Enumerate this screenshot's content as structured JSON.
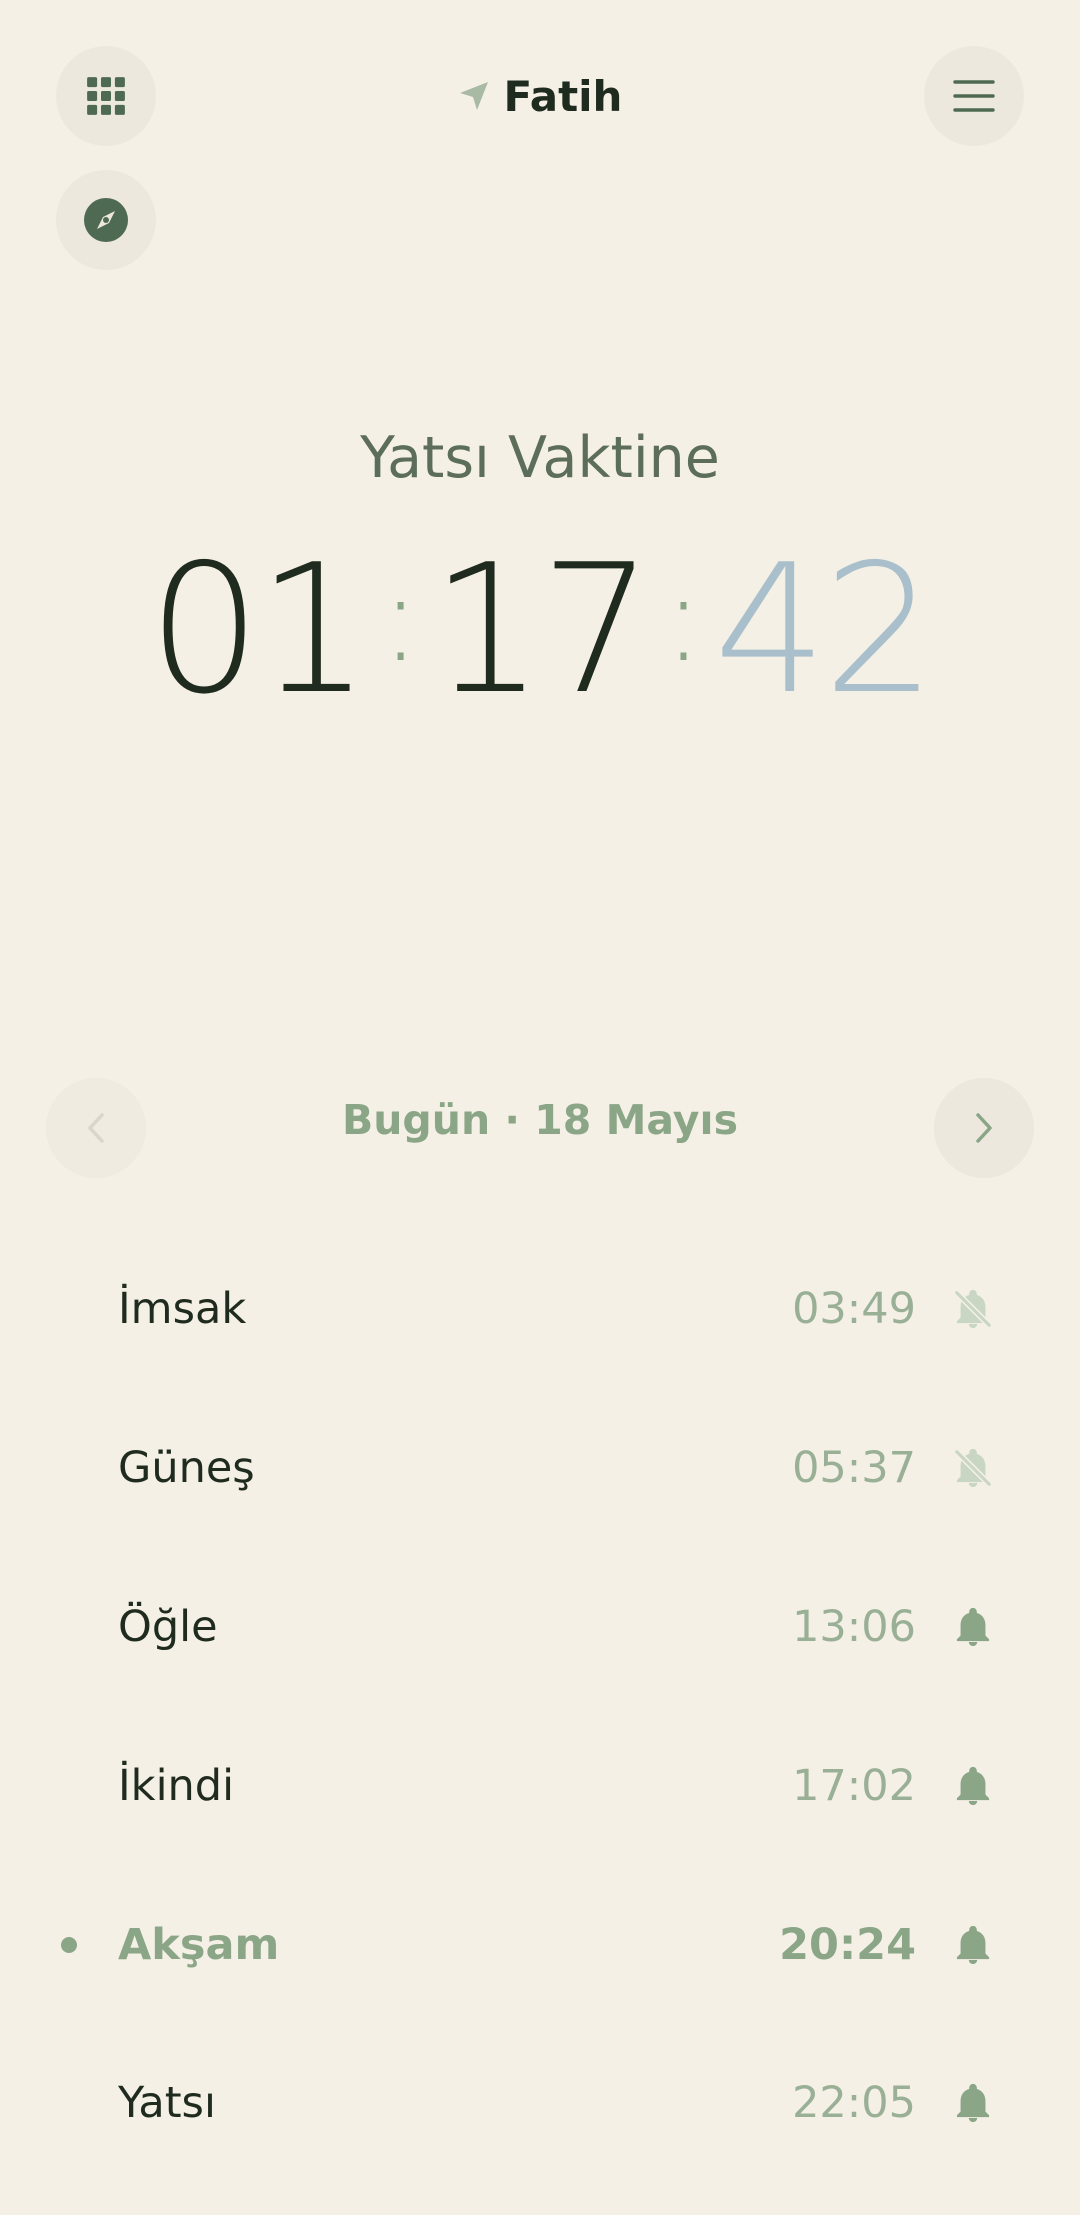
{
  "header": {
    "location": "Fatih",
    "icons": {
      "apps": "grid-icon",
      "qibla": "compass-icon",
      "menu": "hamburger-menu-icon",
      "location": "location-arrow-icon"
    }
  },
  "countdown": {
    "label": "Yatsı Vaktine",
    "hours": "01",
    "minutes": "17",
    "seconds": "42",
    "separator": ":"
  },
  "date_nav": {
    "label": "Bugün · 18 Mayıs",
    "prev_icon": "chevron-left-icon",
    "next_icon": "chevron-right-icon"
  },
  "prayers": [
    {
      "name": "İmsak",
      "time": "03:49",
      "alarm": "bell-off-icon"
    },
    {
      "name": "Güneş",
      "time": "05:37",
      "alarm": "bell-off-icon"
    },
    {
      "name": "Öğle",
      "time": "13:06",
      "alarm": "bell-icon"
    },
    {
      "name": "İkindi",
      "time": "17:02",
      "alarm": "bell-icon"
    },
    {
      "name": "Akşam",
      "time": "20:24",
      "alarm": "bell-icon",
      "current": true
    },
    {
      "name": "Yatsı",
      "time": "22:05",
      "alarm": "bell-icon"
    }
  ],
  "colors": {
    "background": "#f5f0e6",
    "accent": "#8aa687",
    "text": "#1f2b1e",
    "seconds": "#a9c0cc"
  }
}
